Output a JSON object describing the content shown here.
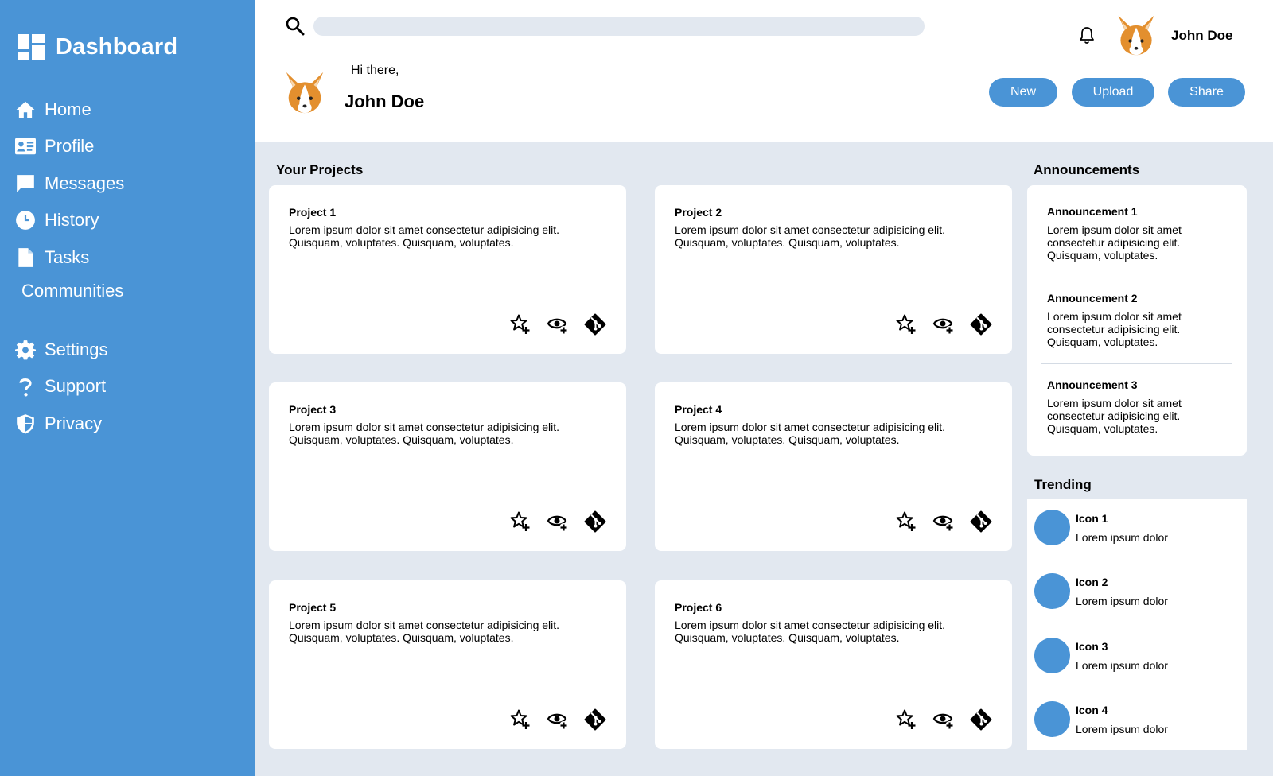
{
  "sidebar": {
    "brand": "Dashboard",
    "items": [
      {
        "label": "Home",
        "icon": "home-icon"
      },
      {
        "label": "Profile",
        "icon": "id-card-icon"
      },
      {
        "label": "Messages",
        "icon": "chat-icon"
      },
      {
        "label": "History",
        "icon": "clock-icon"
      },
      {
        "label": "Tasks",
        "icon": "document-icon"
      },
      {
        "label": "Communities",
        "icon": ""
      },
      {
        "label": "Settings",
        "icon": "gear-icon"
      },
      {
        "label": "Support",
        "icon": "question-icon"
      },
      {
        "label": "Privacy",
        "icon": "shield-icon"
      }
    ]
  },
  "header": {
    "search_placeholder": "",
    "user_name": "John Doe",
    "greeting": "Hi there,",
    "welcome_name": "John Doe",
    "buttons": {
      "new": "New",
      "upload": "Upload",
      "share": "Share"
    }
  },
  "projects": {
    "title": "Your Projects",
    "items": [
      {
        "title": "Project 1",
        "body": "Lorem ipsum dolor sit amet consectetur adipisicing elit. Quisquam, voluptates. Quisquam, voluptates."
      },
      {
        "title": "Project 2",
        "body": "Lorem ipsum dolor sit amet consectetur adipisicing elit. Quisquam, voluptates. Quisquam, voluptates."
      },
      {
        "title": "Project 3",
        "body": "Lorem ipsum dolor sit amet consectetur adipisicing elit. Quisquam, voluptates. Quisquam, voluptates."
      },
      {
        "title": "Project 4",
        "body": "Lorem ipsum dolor sit amet consectetur adipisicing elit. Quisquam, voluptates. Quisquam, voluptates."
      },
      {
        "title": "Project 5",
        "body": "Lorem ipsum dolor sit amet consectetur adipisicing elit. Quisquam, voluptates. Quisquam, voluptates."
      },
      {
        "title": "Project 6",
        "body": "Lorem ipsum dolor sit amet consectetur adipisicing elit. Quisquam, voluptates. Quisquam, voluptates."
      }
    ]
  },
  "announcements": {
    "title": "Announcements",
    "items": [
      {
        "title": "Announcement 1",
        "body": "Lorem ipsum dolor sit amet consectetur adipisicing elit. Quisquam, voluptates."
      },
      {
        "title": "Announcement 2",
        "body": "Lorem ipsum dolor sit amet consectetur adipisicing elit. Quisquam, voluptates."
      },
      {
        "title": "Announcement 3",
        "body": "Lorem ipsum dolor sit amet consectetur adipisicing elit. Quisquam, voluptates."
      }
    ]
  },
  "trending": {
    "title": "Trending",
    "items": [
      {
        "title": "Icon 1",
        "sub": "Lorem ipsum dolor"
      },
      {
        "title": "Icon 2",
        "sub": "Lorem ipsum dolor"
      },
      {
        "title": "Icon 3",
        "sub": "Lorem ipsum dolor"
      },
      {
        "title": "Icon 4",
        "sub": "Lorem ipsum dolor"
      }
    ]
  },
  "colors": {
    "primary": "#4a94d6",
    "background": "#e2e8f0",
    "card": "#ffffff",
    "avatar_orange": "#e38f2e"
  }
}
